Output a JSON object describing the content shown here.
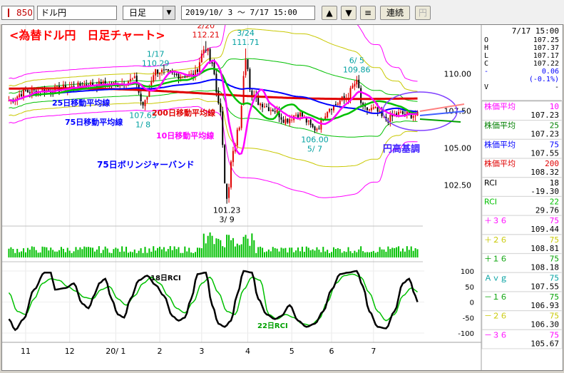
{
  "toolbar": {
    "code": "850",
    "name": "ドル円",
    "period": "日足",
    "range": "2019/10/ 3 ～  7/17 15:00",
    "continuous": "連続",
    "yen": "円"
  },
  "colors": {
    "red": "#e00000",
    "blue": "#0000ff",
    "green": "#00c000",
    "magenta": "#ff00ff",
    "yellow": "#c8c800",
    "purple": "#8040ff"
  },
  "ohlc_panel": {
    "date": "7/17 15:00",
    "rows": [
      {
        "label": "O",
        "value": "107.25",
        "color": "#000"
      },
      {
        "label": "H",
        "value": "107.37",
        "color": "#000"
      },
      {
        "label": "L",
        "value": "107.17",
        "color": "#000"
      },
      {
        "label": "C",
        "value": "107.22",
        "color": "#000"
      },
      {
        "label": "-",
        "value": "0.06",
        "color": "#0000ff"
      },
      {
        "label": "",
        "value": "(-0.1%)",
        "color": "#0000ff"
      },
      {
        "label": "V",
        "value": "-",
        "color": "#000"
      }
    ]
  },
  "indicators": [
    {
      "name": "株価平均",
      "param": "10",
      "value": "107.23",
      "color": "#ff00ff",
      "bg": "#ffffff"
    },
    {
      "name": "株価平均",
      "param": "25",
      "value": "107.23",
      "color": "#008000",
      "bg": "#ffffff"
    },
    {
      "name": "株価平均",
      "param": "75",
      "value": "107.55",
      "color": "#0000ff",
      "bg": "#ffffff"
    },
    {
      "name": "株価平均",
      "param": "200",
      "value": "108.32",
      "color": "#e00000",
      "bg": "#ffffff"
    },
    {
      "name": "RCI",
      "param": "18",
      "value": "-19.30",
      "color": "#000000",
      "bg": "#ffffff"
    },
    {
      "name": "RCI",
      "param": "22",
      "value": "29.76",
      "color": "#00c000",
      "bg": "#ffffff"
    },
    {
      "name": "＋３６",
      "param": "75",
      "value": "109.44",
      "color": "#ff00ff",
      "bg": "#ffffff"
    },
    {
      "name": "＋２６",
      "param": "75",
      "value": "108.81",
      "color": "#c8c800",
      "bg": "#ffffff"
    },
    {
      "name": "＋１６",
      "param": "75",
      "value": "108.18",
      "color": "#00a000",
      "bg": "#ffffff"
    },
    {
      "name": "Ａｖｇ",
      "param": "75",
      "value": "107.55",
      "color": "#00a0a0",
      "bg": "#ffffff"
    },
    {
      "name": "－１６",
      "param": "75",
      "value": "106.93",
      "color": "#00a000",
      "bg": "#ffffff"
    },
    {
      "name": "－２６",
      "param": "75",
      "value": "106.30",
      "color": "#c8c800",
      "bg": "#ffffff"
    },
    {
      "name": "－３６",
      "param": "75",
      "value": "105.67",
      "color": "#ff00ff",
      "bg": "#ffffff"
    }
  ],
  "annotations": {
    "title": "<為替ドル円　日足チャート>",
    "ma25": "25日移動平均線",
    "ma75": "75日移動平均線",
    "ma200": "200日移動平均線",
    "ma10": "10日移動平均線",
    "bollinger": "75日ボリンジャーバンド",
    "yen_trend": "円高基調",
    "rci18": "18日RCI",
    "rci22": "22日RCI"
  },
  "chart_data": {
    "type": "line",
    "price_axis": {
      "ticks": [
        110.0,
        107.5,
        105.0,
        102.5
      ],
      "ylim": [
        100.3,
        113.3
      ]
    },
    "rci_axis": {
      "ticks": [
        100,
        50,
        0,
        -50,
        -100
      ],
      "ylim": [
        -100,
        100
      ]
    },
    "x_labels": [
      {
        "label": "11",
        "index": 8
      },
      {
        "label": "12",
        "index": 29
      },
      {
        "label": "20/ 1",
        "index": 51
      },
      {
        "label": "2",
        "index": 72
      },
      {
        "label": "3",
        "index": 92
      },
      {
        "label": "4",
        "index": 114
      },
      {
        "label": "5",
        "index": 135
      },
      {
        "label": "6",
        "index": 154
      },
      {
        "label": "7",
        "index": 174
      }
    ],
    "n": 196,
    "price_labels": [
      {
        "date": "1/17",
        "value": "110.29",
        "index": 70,
        "price": 110.29,
        "color": "#00a0a0",
        "pos": "above"
      },
      {
        "date": "2/20",
        "value": "112.21",
        "index": 94,
        "price": 112.21,
        "color": "#e00000",
        "pos": "above"
      },
      {
        "date": "3/24",
        "value": "111.71",
        "index": 113,
        "price": 111.71,
        "color": "#00a0a0",
        "pos": "above"
      },
      {
        "date": "6/ 5",
        "value": "109.86",
        "index": 166,
        "price": 109.86,
        "color": "#00a0a0",
        "pos": "above"
      },
      {
        "date": "1/ 8",
        "value": "107.65",
        "index": 64,
        "price": 107.65,
        "color": "#00a0a0",
        "pos": "below"
      },
      {
        "date": "5/ 7",
        "value": "106.00",
        "index": 146,
        "price": 106.0,
        "color": "#00a0a0",
        "pos": "below"
      },
      {
        "date": "3/ 9",
        "value": "101.23",
        "index": 104,
        "price": 101.23,
        "color": "#000000",
        "pos": "below"
      }
    ],
    "close_keypoints": [
      [
        0,
        108.2
      ],
      [
        8,
        108.8
      ],
      [
        20,
        108.9
      ],
      [
        29,
        109.1
      ],
      [
        38,
        109.3
      ],
      [
        51,
        109.3
      ],
      [
        60,
        109.6
      ],
      [
        64,
        107.9
      ],
      [
        70,
        110.2
      ],
      [
        80,
        109.9
      ],
      [
        88,
        109.9
      ],
      [
        94,
        111.8
      ],
      [
        97,
        110.5
      ],
      [
        100,
        108.2
      ],
      [
        104,
        101.8
      ],
      [
        107,
        104.7
      ],
      [
        110,
        106.5
      ],
      [
        113,
        111.2
      ],
      [
        116,
        108.5
      ],
      [
        120,
        108.0
      ],
      [
        126,
        107.6
      ],
      [
        132,
        106.9
      ],
      [
        138,
        107.3
      ],
      [
        146,
        106.3
      ],
      [
        154,
        107.8
      ],
      [
        160,
        108.3
      ],
      [
        166,
        109.4
      ],
      [
        169,
        107.6
      ],
      [
        174,
        107.6
      ],
      [
        180,
        106.9
      ],
      [
        186,
        107.3
      ],
      [
        196,
        107.2
      ]
    ],
    "series": [
      {
        "name": "株価平均 10",
        "values_last": 107.23
      },
      {
        "name": "株価平均 25",
        "values_last": 107.23
      },
      {
        "name": "株価平均 75",
        "values_last": 107.55
      },
      {
        "name": "株価平均 200",
        "values_last": 108.32
      }
    ],
    "rci18_keypoints": [
      [
        0,
        -55
      ],
      [
        3,
        -90
      ],
      [
        7,
        -55
      ],
      [
        12,
        40
      ],
      [
        17,
        95
      ],
      [
        20,
        95
      ],
      [
        22,
        40
      ],
      [
        27,
        45
      ],
      [
        31,
        60
      ],
      [
        35,
        -5
      ],
      [
        38,
        -20
      ],
      [
        41,
        25
      ],
      [
        43,
        60
      ],
      [
        46,
        75
      ],
      [
        49,
        10
      ],
      [
        52,
        -40
      ],
      [
        55,
        -50
      ],
      [
        58,
        10
      ],
      [
        62,
        70
      ],
      [
        66,
        85
      ],
      [
        70,
        55
      ],
      [
        74,
        20
      ],
      [
        78,
        -45
      ],
      [
        81,
        -60
      ],
      [
        84,
        -50
      ],
      [
        87,
        10
      ],
      [
        90,
        90
      ],
      [
        94,
        95
      ],
      [
        97,
        -10
      ],
      [
        100,
        -70
      ],
      [
        103,
        -80
      ],
      [
        106,
        -60
      ],
      [
        109,
        25
      ],
      [
        112,
        100
      ],
      [
        116,
        95
      ],
      [
        119,
        10
      ],
      [
        123,
        -40
      ],
      [
        127,
        -55
      ],
      [
        130,
        -45
      ],
      [
        134,
        -10
      ],
      [
        138,
        -60
      ],
      [
        142,
        -80
      ],
      [
        146,
        -70
      ],
      [
        150,
        -30
      ],
      [
        154,
        40
      ],
      [
        158,
        90
      ],
      [
        162,
        95
      ],
      [
        166,
        100
      ],
      [
        169,
        50
      ],
      [
        172,
        -30
      ],
      [
        176,
        -80
      ],
      [
        180,
        -85
      ],
      [
        184,
        -30
      ],
      [
        188,
        60
      ],
      [
        191,
        75
      ],
      [
        194,
        20
      ],
      [
        196,
        -20
      ]
    ],
    "rci22_keypoints": [
      [
        0,
        30
      ],
      [
        4,
        -30
      ],
      [
        8,
        -40
      ],
      [
        12,
        10
      ],
      [
        16,
        60
      ],
      [
        20,
        75
      ],
      [
        24,
        70
      ],
      [
        28,
        50
      ],
      [
        32,
        35
      ],
      [
        36,
        15
      ],
      [
        40,
        10
      ],
      [
        44,
        40
      ],
      [
        48,
        50
      ],
      [
        52,
        10
      ],
      [
        56,
        -10
      ],
      [
        60,
        20
      ],
      [
        64,
        60
      ],
      [
        68,
        80
      ],
      [
        72,
        60
      ],
      [
        76,
        20
      ],
      [
        80,
        -20
      ],
      [
        84,
        -35
      ],
      [
        88,
        0
      ],
      [
        92,
        60
      ],
      [
        96,
        80
      ],
      [
        100,
        30
      ],
      [
        104,
        -30
      ],
      [
        108,
        -40
      ],
      [
        112,
        40
      ],
      [
        116,
        80
      ],
      [
        120,
        70
      ],
      [
        124,
        -40
      ],
      [
        128,
        -55
      ],
      [
        132,
        -40
      ],
      [
        136,
        -50
      ],
      [
        140,
        -70
      ],
      [
        144,
        -75
      ],
      [
        148,
        -55
      ],
      [
        152,
        0
      ],
      [
        156,
        60
      ],
      [
        160,
        85
      ],
      [
        164,
        90
      ],
      [
        168,
        80
      ],
      [
        172,
        30
      ],
      [
        176,
        -30
      ],
      [
        180,
        -60
      ],
      [
        184,
        -40
      ],
      [
        188,
        20
      ],
      [
        192,
        45
      ],
      [
        196,
        30
      ]
    ]
  }
}
